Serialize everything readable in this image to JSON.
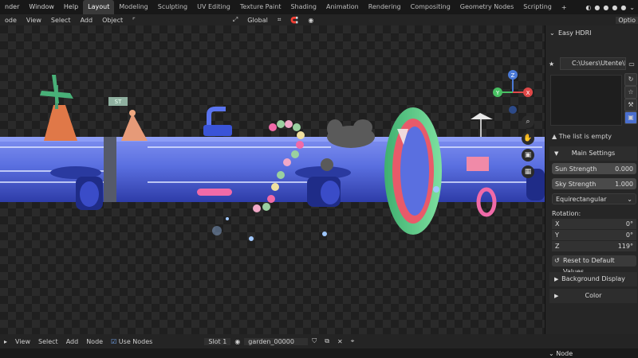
{
  "topbar": {
    "menus": [
      "nder",
      "Window",
      "Help"
    ],
    "tabs": [
      "Layout",
      "Modeling",
      "Sculpting",
      "UV Editing",
      "Texture Paint",
      "Shading",
      "Animation",
      "Rendering",
      "Compositing",
      "Geometry Nodes",
      "Scripting"
    ],
    "active_tab": "Layout",
    "add_tab": "+"
  },
  "toolbar": {
    "items": [
      "ode",
      "View",
      "Select",
      "Add",
      "Object"
    ],
    "transform": "Global",
    "options": "Optio"
  },
  "panel": {
    "title": "Easy HDRI",
    "path": "C:\\Users\\Utente\\Dr...",
    "list_empty": "The list is empty",
    "main_settings": "Main Settings",
    "sun_strength_label": "Sun Strength",
    "sun_strength_value": "0.000",
    "sky_strength_label": "Sky Strength",
    "sky_strength_value": "1.000",
    "projection": "Equirectangular",
    "rotation_label": "Rotation:",
    "rot_x_label": "X",
    "rot_x": "0°",
    "rot_y_label": "Y",
    "rot_y": "0°",
    "rot_z_label": "Z",
    "rot_z": "119°",
    "reset": "Reset to Default Values",
    "background_display": "Background Display",
    "color": "Color"
  },
  "viewport": {
    "tag": "ST",
    "gizmo_z": "Z",
    "gizmo_x": "X",
    "gizmo_y": "Y"
  },
  "bottombar": {
    "items": [
      "View",
      "Select",
      "Add",
      "Node"
    ],
    "use_nodes": "Use Nodes",
    "slot": "Slot 1",
    "material": "garden_00000"
  },
  "bottom": {
    "node": "Node"
  },
  "colors": {
    "tube": "#5a6fe0",
    "accent_red": "#e04848",
    "accent_green": "#48c062",
    "accent_blue": "#4a7ad8",
    "active_tab": "#3a3a3a"
  }
}
